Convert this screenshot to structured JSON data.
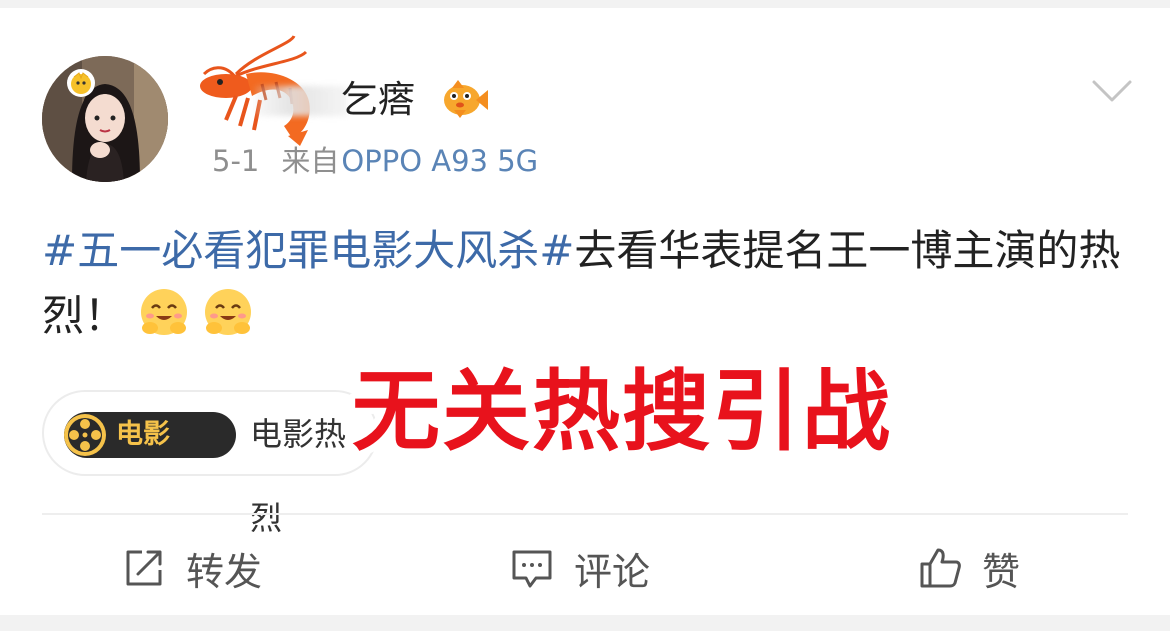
{
  "post": {
    "username": "乞瘩",
    "date": "5-1",
    "source_prefix": "来自",
    "source": "OPPO A93 5G",
    "hashtag": "#五一必看犯罪电影大风杀#",
    "text": "去看华表提名王一博主演的热烈！",
    "emojis": [
      "smile-hug-emoji",
      "smile-hug-emoji"
    ]
  },
  "topic_pill": {
    "badge": "电影",
    "label": "电影热烈"
  },
  "overlay_caption": "无关热搜引战",
  "actions": {
    "repost": "转发",
    "comment": "评论",
    "like": "赞"
  },
  "colors": {
    "link": "#3d6aa8",
    "source": "#5a84b6",
    "overlay_text": "#e8121c",
    "badge_bg": "#2a2a2a",
    "badge_text": "#f5c24a"
  }
}
